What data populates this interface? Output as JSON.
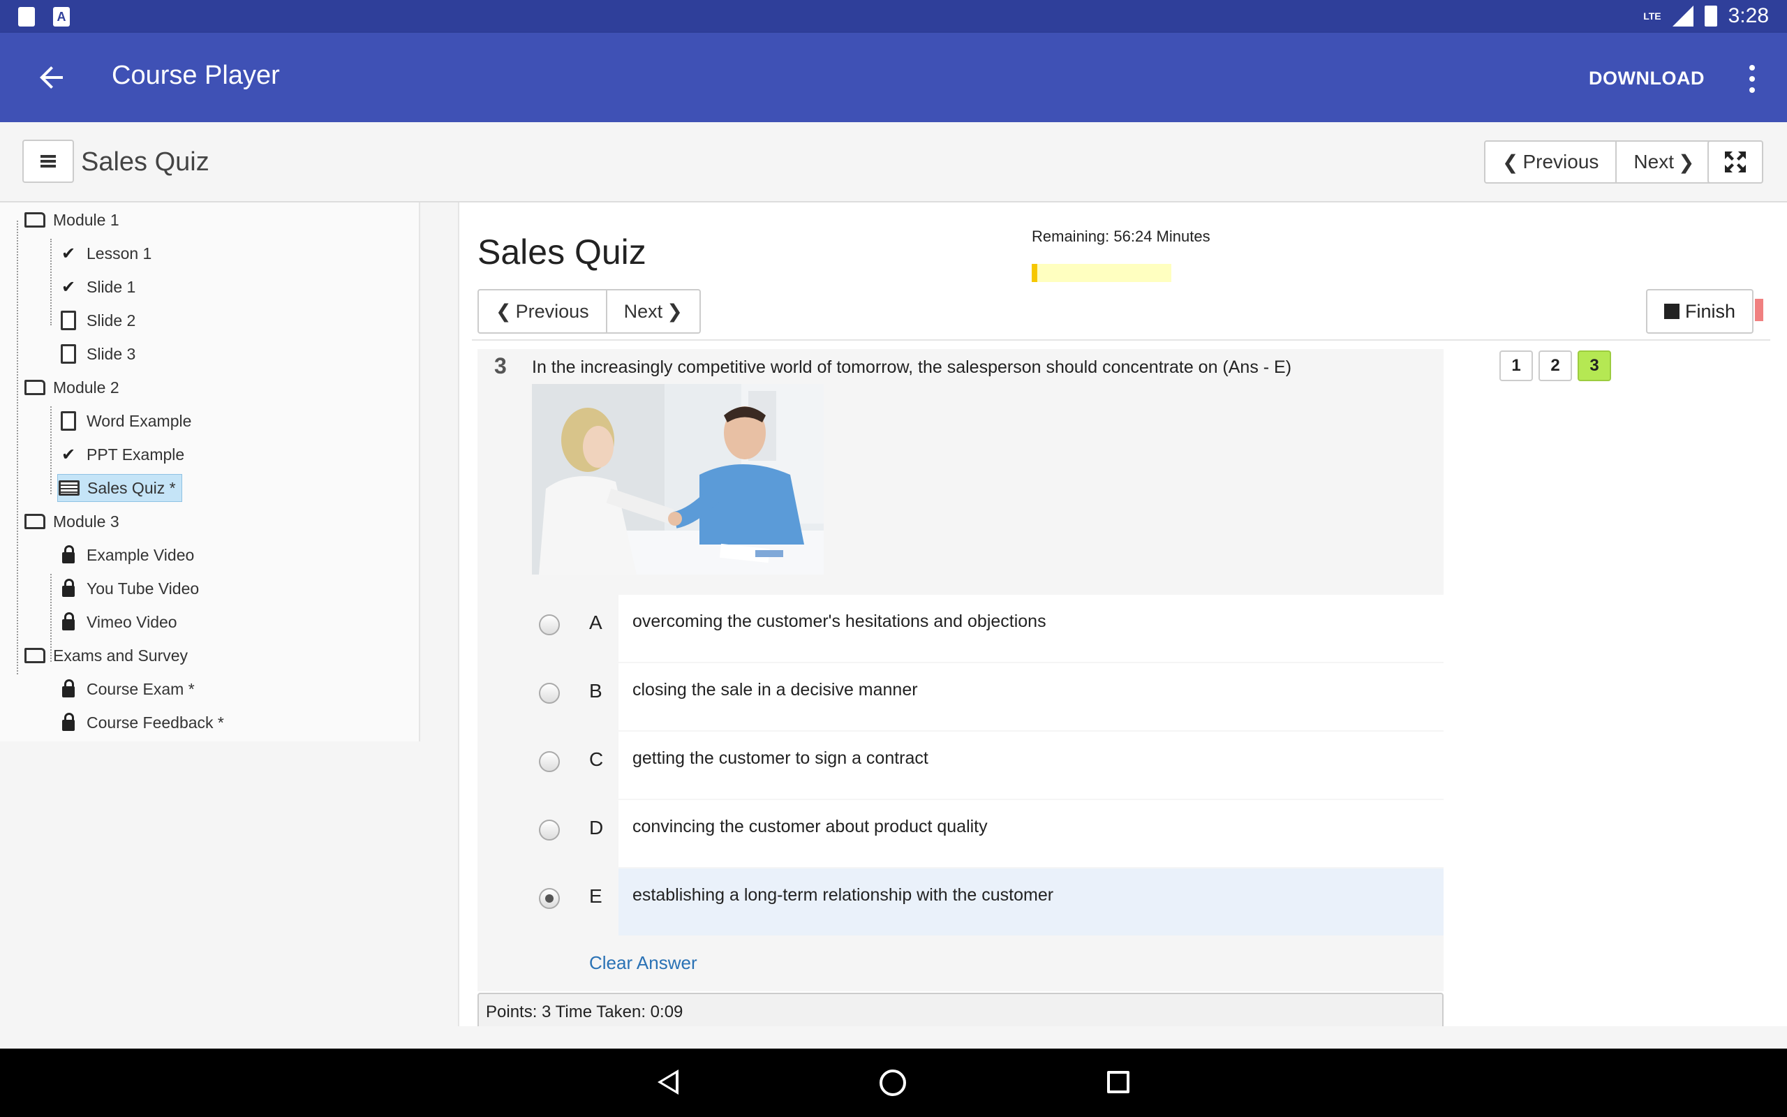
{
  "status_bar": {
    "time": "3:28",
    "network": "LTE"
  },
  "app_bar": {
    "title": "Course Player",
    "download_label": "DOWNLOAD"
  },
  "toolbar": {
    "course_title": "Sales Quiz",
    "previous_label": "Previous",
    "next_label": "Next"
  },
  "sidebar": {
    "items": [
      {
        "label": "Module 1",
        "icon": "folder-open-icon"
      },
      {
        "label": "Lesson 1",
        "icon": "check-icon"
      },
      {
        "label": "Slide 1",
        "icon": "check-icon"
      },
      {
        "label": "Slide 2",
        "icon": "video-file-icon"
      },
      {
        "label": "Slide 3",
        "icon": "video-file-icon"
      },
      {
        "label": "Module 2",
        "icon": "folder-open-icon"
      },
      {
        "label": "Word Example",
        "icon": "document-icon"
      },
      {
        "label": "PPT Example",
        "icon": "check-icon"
      },
      {
        "label": "Sales Quiz *",
        "icon": "list-icon"
      },
      {
        "label": "Module 3",
        "icon": "folder-open-icon"
      },
      {
        "label": "Example Video",
        "icon": "lock-icon"
      },
      {
        "label": "You Tube Video",
        "icon": "lock-icon"
      },
      {
        "label": "Vimeo Video",
        "icon": "lock-icon"
      },
      {
        "label": "Exams and Survey",
        "icon": "folder-open-icon"
      },
      {
        "label": "Course Exam *",
        "icon": "lock-icon"
      },
      {
        "label": "Course Feedback *",
        "icon": "lock-icon"
      }
    ]
  },
  "quiz": {
    "title": "Sales Quiz",
    "remaining": "Remaining: 56:24 Minutes",
    "time_progress": 0.04,
    "previous_label": "Previous",
    "next_label": "Next",
    "finish_label": "Finish",
    "question_number": "3",
    "question_text": "In the increasingly competitive world of tomorrow, the salesperson should concentrate on (Ans - E)",
    "answers": [
      {
        "letter": "A",
        "text": "overcoming the customer's hesitations and objections",
        "selected": false
      },
      {
        "letter": "B",
        "text": "closing the sale in a decisive manner",
        "selected": false
      },
      {
        "letter": "C",
        "text": "getting the customer to sign a contract",
        "selected": false
      },
      {
        "letter": "D",
        "text": "convincing the customer about product quality",
        "selected": false
      },
      {
        "letter": "E",
        "text": "establishing a long-term relationship with the customer",
        "selected": true
      }
    ],
    "clear_label": "Clear Answer",
    "points_text": "Points: 3 Time Taken: 0:09",
    "pages": [
      "1",
      "2",
      "3"
    ],
    "current_page": "3"
  },
  "colors": {
    "status_bar": "#2f3f9a",
    "app_bar": "#3f51b5",
    "current_page": "#b5e853",
    "link": "#2a72b5"
  }
}
